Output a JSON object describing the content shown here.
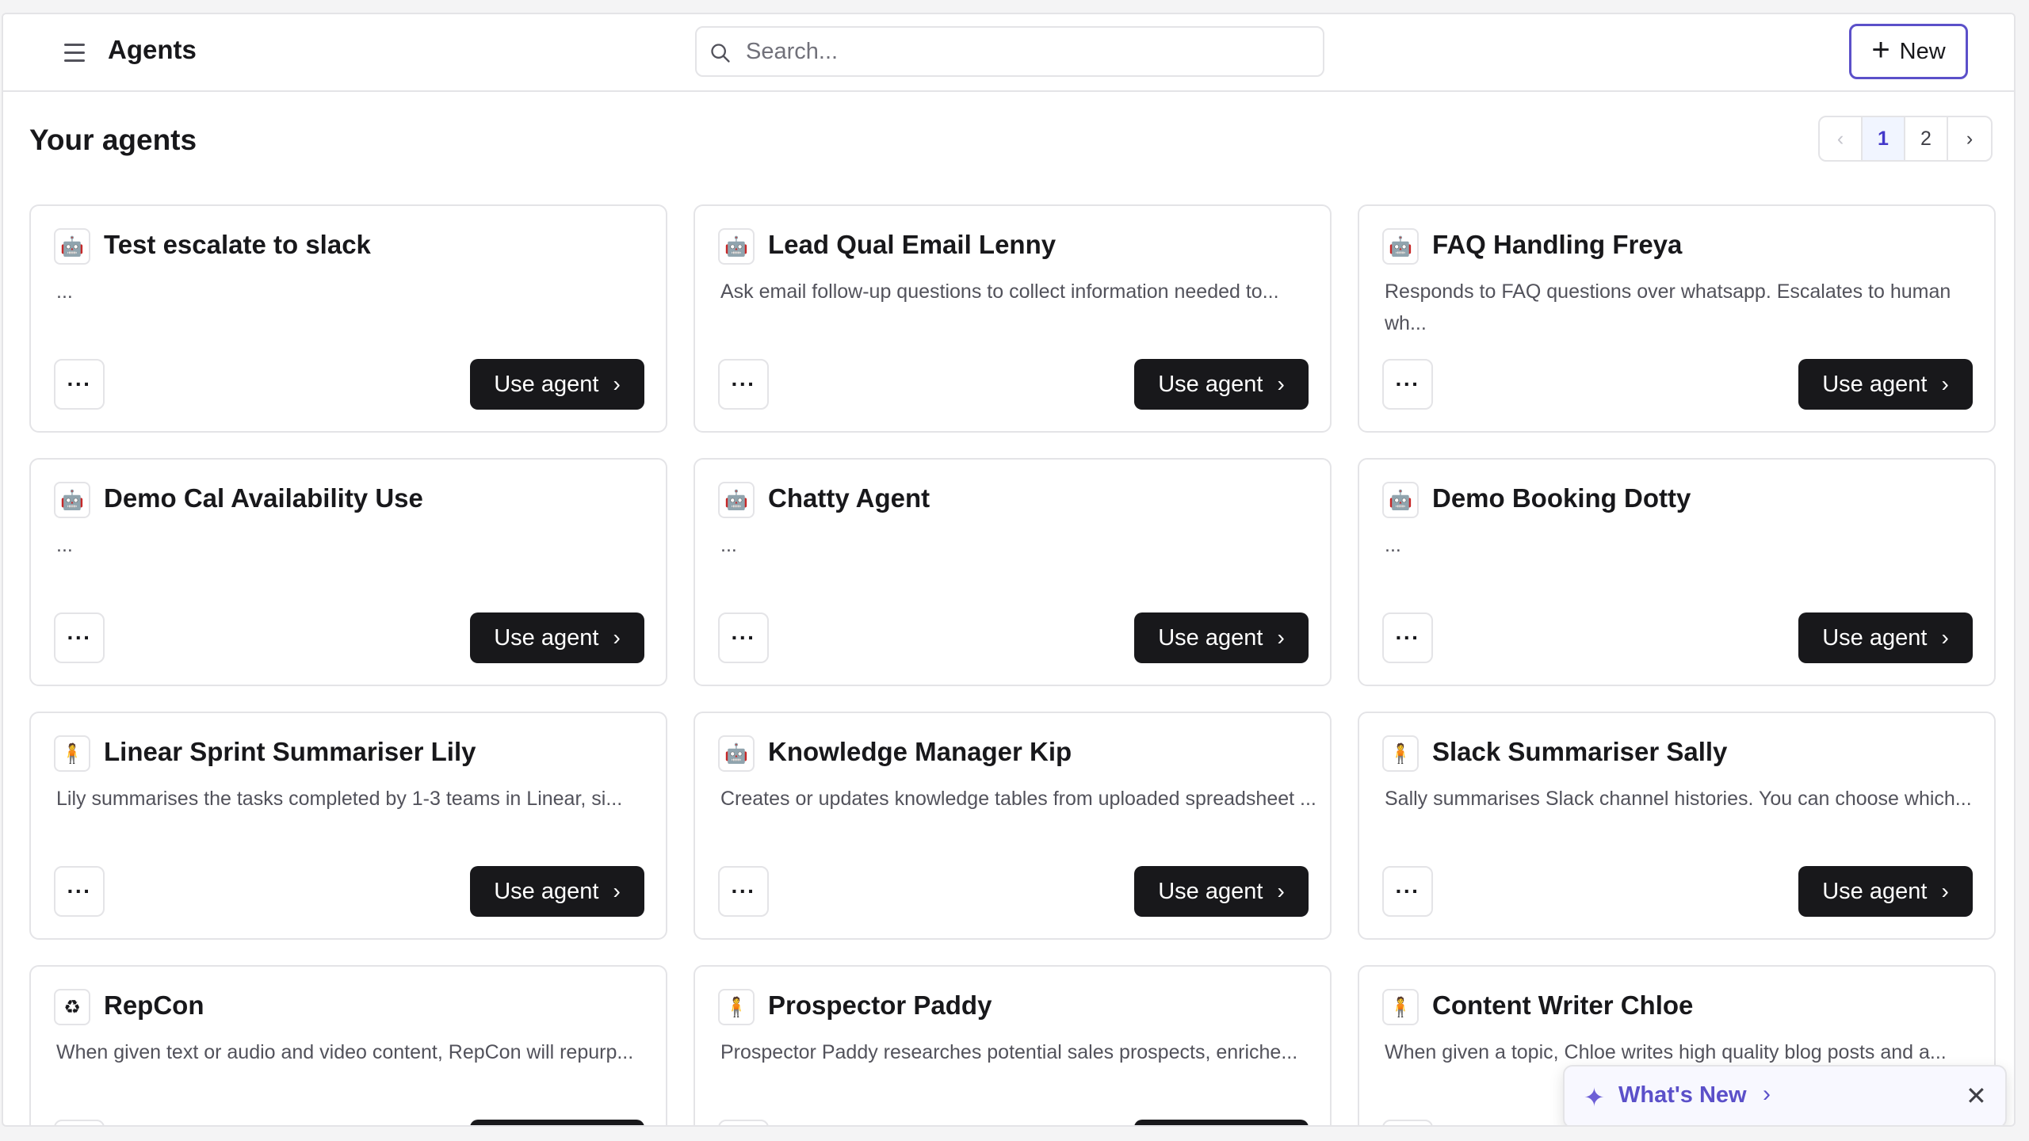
{
  "header": {
    "title": "Agents",
    "search_placeholder": "Search...",
    "new_label": "New"
  },
  "section": {
    "title": "Your agents"
  },
  "pagination": {
    "prev": "‹",
    "pages": [
      "1",
      "2"
    ],
    "current": "1",
    "next": "›"
  },
  "card_actions": {
    "more_label": "···",
    "use_label": "Use agent",
    "use_chevron": "›"
  },
  "agents": [
    {
      "title": "Test escalate to slack",
      "desc": "...",
      "icon": "robot-icon",
      "glyph": "🤖"
    },
    {
      "title": "Lead Qual Email Lenny",
      "desc": "Ask email follow-up questions to collect information needed to...",
      "icon": "robot-icon",
      "glyph": "🤖"
    },
    {
      "title": "FAQ Handling Freya",
      "desc": "Responds to FAQ questions over whatsapp. Escalates to human wh...",
      "icon": "robot-icon",
      "glyph": "🤖"
    },
    {
      "title": "Demo Cal Availability Use",
      "desc": "...",
      "icon": "robot-icon",
      "glyph": "🤖"
    },
    {
      "title": "Chatty Agent",
      "desc": "...",
      "icon": "robot-icon",
      "glyph": "🤖"
    },
    {
      "title": "Demo Booking Dotty",
      "desc": "...",
      "icon": "robot-icon",
      "glyph": "🤖"
    },
    {
      "title": "Linear Sprint Summariser Lily",
      "desc": "Lily summarises the tasks completed by 1-3 teams in Linear, si...",
      "icon": "character-avatar-icon",
      "glyph": "🧍"
    },
    {
      "title": "Knowledge Manager Kip",
      "desc": "Creates or updates knowledge tables from uploaded spreadsheet ...",
      "icon": "robot-icon",
      "glyph": "🤖"
    },
    {
      "title": "Slack Summariser Sally",
      "desc": "Sally summarises Slack channel histories. You can choose which...",
      "icon": "character-avatar-icon",
      "glyph": "🧍"
    },
    {
      "title": "RepCon",
      "desc": "When given text or audio and video content, RepCon will repurp...",
      "icon": "recycle-icon",
      "glyph": "♻"
    },
    {
      "title": "Prospector Paddy",
      "desc": "Prospector Paddy researches potential sales prospects, enriche...",
      "icon": "character-avatar-icon",
      "glyph": "🧍"
    },
    {
      "title": "Content Writer Chloe",
      "desc": "When given a topic, Chloe writes high quality blog posts and a...",
      "icon": "character-avatar-icon",
      "glyph": "🧍"
    }
  ],
  "toast": {
    "label": "What's New",
    "close": "✕"
  },
  "colors": {
    "accent": "#5b50c9",
    "button_dark": "#18181b",
    "border": "#e4e4e7"
  }
}
